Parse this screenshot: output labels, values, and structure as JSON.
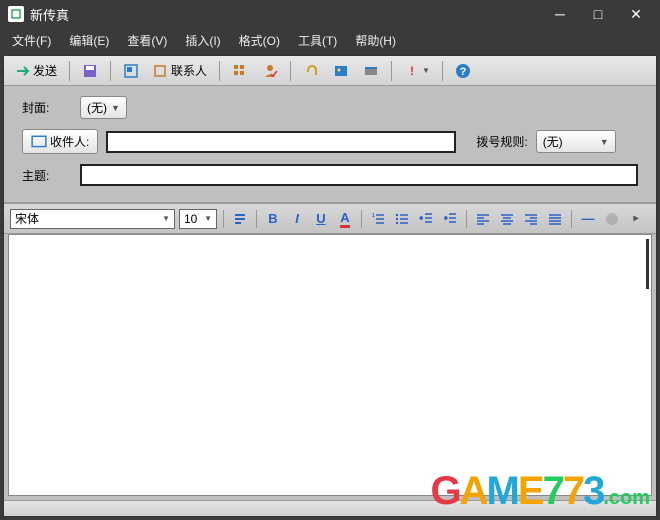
{
  "window": {
    "title": "新传真"
  },
  "menu": {
    "file": "文件(F)",
    "edit": "编辑(E)",
    "view": "查看(V)",
    "insert": "插入(I)",
    "format": "格式(O)",
    "tools": "工具(T)",
    "help": "帮助(H)"
  },
  "toolbar": {
    "send": "发送",
    "contacts": "联系人"
  },
  "form": {
    "cover_label": "封面:",
    "cover_value": "(无)",
    "recipient_btn": "收件人:",
    "recipient_value": "",
    "dialrule_label": "拨号规则:",
    "dialrule_value": "(无)",
    "subject_label": "主题:",
    "subject_value": ""
  },
  "editor": {
    "font": "宋体",
    "size": "10"
  },
  "watermark": {
    "text": "GAME773.com"
  }
}
